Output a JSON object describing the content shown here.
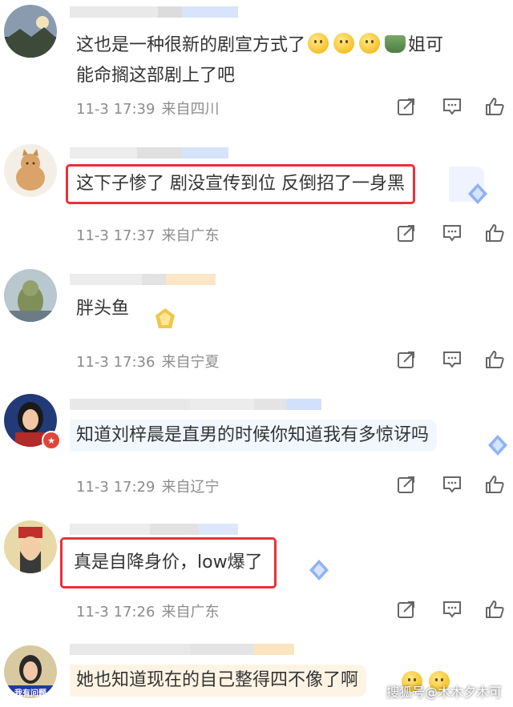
{
  "comments": [
    {
      "text_a": "这也是一种很新的剧宣方式了",
      "text_b": "姐可",
      "text_line2": "能命搁这部剧上了吧",
      "date": "11-3 17:39",
      "location": "来自四川",
      "highlighted": false
    },
    {
      "text": "这下子惨了 剧没宣传到位 反倒招了一身黑",
      "date": "11-3 17:37",
      "location": "来自广东",
      "highlighted": true
    },
    {
      "text": "胖头鱼",
      "date": "11-3 17:36",
      "location": "来自宁夏",
      "highlighted": false
    },
    {
      "text": "知道刘梓晨是直男的时候你知道我有多惊讶吗",
      "date": "11-3 17:29",
      "location": "来自辽宁",
      "highlighted": false
    },
    {
      "text": "真是自降身价，low爆了",
      "date": "11-3 17:26",
      "location": "来自广东",
      "highlighted": true
    },
    {
      "text": "她也知道现在的自己整得四不像了啊",
      "highlighted": false
    }
  ],
  "avatar6_label": "我有问题",
  "watermark": "搜狐号@木木夕木可",
  "icons": {
    "share": "share-icon",
    "comment": "comment-icon",
    "like": "like-icon"
  },
  "colors": {
    "highlight": "#e5323a",
    "meta": "#8c8c8c",
    "icon": "#666666"
  }
}
